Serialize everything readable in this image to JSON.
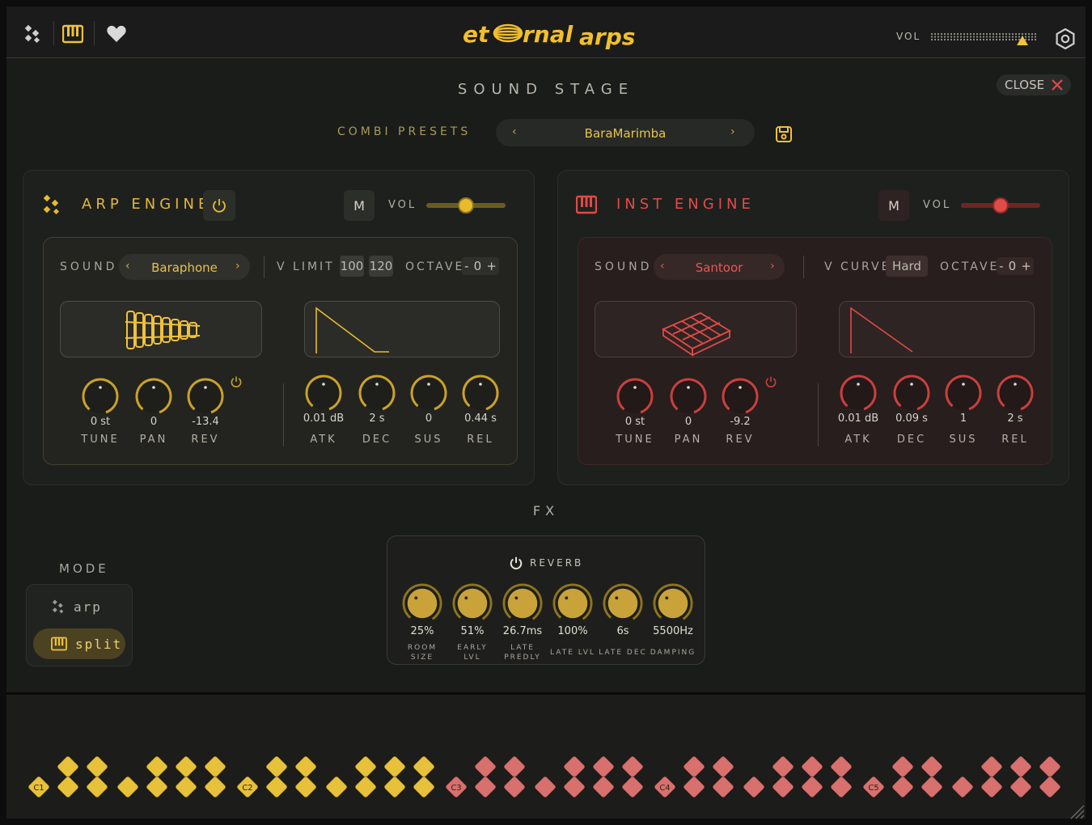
{
  "header": {
    "vol_label": "VOL",
    "logo_left": "et",
    "logo_right": "rnal",
    "logo_arps": "arps",
    "icons": [
      "arp-mode-icon",
      "keyboard-icon",
      "heart-icon",
      "settings-icon"
    ]
  },
  "stage": {
    "title": "SOUND STAGE",
    "close_label": "CLOSE",
    "combi_label": "COMBI PRESETS",
    "preset_name": "BaraMarimba"
  },
  "arp_engine": {
    "title": "ARP ENGINE",
    "mute": "M",
    "vol_label": "VOL",
    "vol_level": 0.5,
    "sound_label": "SOUND",
    "sound_name": "Baraphone",
    "v_label": "V LIMIT",
    "v_values": [
      "100",
      "120"
    ],
    "octave_label": "OCTAVE",
    "octave_minus": "-",
    "octave_value": "0",
    "octave_plus": "+",
    "knobs": [
      {
        "value": "0 st",
        "label": "TUNE"
      },
      {
        "value": "0",
        "label": "PAN"
      },
      {
        "value": "-13.4",
        "label": "REV"
      }
    ],
    "env": [
      {
        "value": "0.01 dB",
        "label": "ATK"
      },
      {
        "value": "2 s",
        "label": "DEC"
      },
      {
        "value": "0",
        "label": "SUS"
      },
      {
        "value": "0.44 s",
        "label": "REL"
      }
    ]
  },
  "inst_engine": {
    "title": "INST ENGINE",
    "mute": "M",
    "vol_label": "VOL",
    "vol_level": 0.5,
    "sound_label": "SOUND",
    "sound_name": "Santoor",
    "v_label": "V CURVE",
    "v_values": [
      "Hard"
    ],
    "octave_label": "OCTAVE",
    "octave_minus": "-",
    "octave_value": "0",
    "octave_plus": "+",
    "knobs": [
      {
        "value": "0 st",
        "label": "TUNE"
      },
      {
        "value": "0",
        "label": "PAN"
      },
      {
        "value": "-9.2",
        "label": "REV"
      }
    ],
    "env": [
      {
        "value": "0.01 dB",
        "label": "ATK"
      },
      {
        "value": "0.09 s",
        "label": "DEC"
      },
      {
        "value": "1",
        "label": "SUS"
      },
      {
        "value": "2 s",
        "label": "REL"
      }
    ]
  },
  "fx": {
    "title": "FX",
    "reverb_label": "REVERB",
    "params": [
      {
        "value": "25%",
        "label1": "ROOM",
        "label2": "SIZE"
      },
      {
        "value": "51%",
        "label1": "EARLY",
        "label2": "LVL"
      },
      {
        "value": "26.7ms",
        "label1": "LATE",
        "label2": "PREDLY"
      },
      {
        "value": "100%",
        "label1": "LATE LVL",
        "label2": ""
      },
      {
        "value": "6s",
        "label1": "LATE DEC",
        "label2": ""
      },
      {
        "value": "5500Hz",
        "label1": "DAMPING",
        "label2": ""
      }
    ]
  },
  "mode": {
    "title": "MODE",
    "arp_label": "arp",
    "split_label": "split",
    "selected": "split"
  },
  "keyboard": {
    "octave_labels": [
      "C1",
      "C2",
      "C3",
      "C4",
      "C5"
    ],
    "split_colors": {
      "arp": "#e8c13a",
      "inst": "#d8706e"
    }
  },
  "colors": {
    "arp_accent": "#e8bb2e",
    "inst_accent": "#e04a47"
  }
}
